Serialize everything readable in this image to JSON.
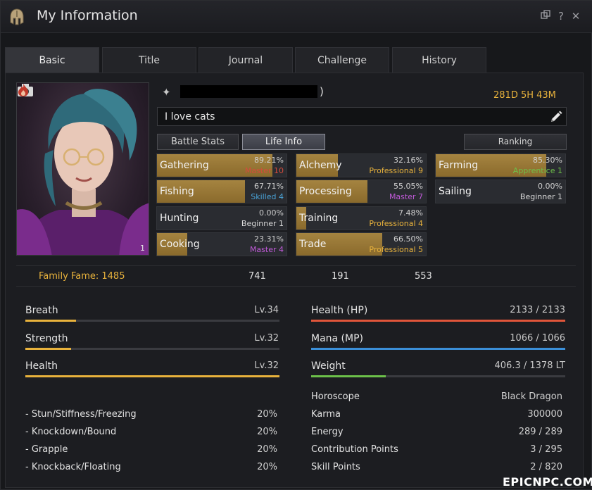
{
  "window": {
    "title": "My Information",
    "icons": {
      "title": "helmet-icon",
      "restore": "restore-icon",
      "help": "?",
      "close": "✕"
    }
  },
  "tabs": [
    {
      "label": "Basic",
      "active": true
    },
    {
      "label": "Title"
    },
    {
      "label": "Journal"
    },
    {
      "label": "Challenge"
    },
    {
      "label": "History"
    }
  ],
  "profile": {
    "name_suffix": ")",
    "playtime": "281D 5H 43M",
    "motto": "I love cats",
    "fire_count": "1"
  },
  "subtabs": {
    "battle": "Battle Stats",
    "life": "Life Info",
    "ranking": "Ranking"
  },
  "life_skills": [
    {
      "name": "Gathering",
      "pct": "89.21%",
      "level": "Master 10",
      "level_color": "#d44b3c",
      "fill": 0.8921
    },
    {
      "name": "Fishing",
      "pct": "67.71%",
      "level": "Skilled 4",
      "level_color": "#4aa3d8",
      "fill": 0.6771
    },
    {
      "name": "Hunting",
      "pct": "0.00%",
      "level": "Beginner 1",
      "level_color": "#d8d8d8",
      "fill": 0.0
    },
    {
      "name": "Cooking",
      "pct": "23.31%",
      "level": "Master 4",
      "level_color": "#c05ad8",
      "fill": 0.2331
    },
    {
      "name": "Alchemy",
      "pct": "32.16%",
      "level": "Professional 9",
      "level_color": "#e8b23c",
      "fill": 0.3216
    },
    {
      "name": "Processing",
      "pct": "55.05%",
      "level": "Master 7",
      "level_color": "#c05ad8",
      "fill": 0.5505
    },
    {
      "name": "Training",
      "pct": "7.48%",
      "level": "Professional 4",
      "level_color": "#e8b23c",
      "fill": 0.0748
    },
    {
      "name": "Trade",
      "pct": "66.50%",
      "level": "Professional 5",
      "level_color": "#e8b23c",
      "fill": 0.665
    },
    {
      "name": "Farming",
      "pct": "85.30%",
      "level": "Apprentice 1",
      "level_color": "#6ec04a",
      "fill": 0.853
    },
    {
      "name": "Sailing",
      "pct": "0.00%",
      "level": "Beginner 1",
      "level_color": "#d8d8d8",
      "fill": 0.0
    }
  ],
  "fame": {
    "label": "Family Fame: 1485",
    "a": "741",
    "b": "191",
    "c": "553"
  },
  "stats": [
    {
      "name": "Breath",
      "level": "Lv.34",
      "fill": 0.2,
      "color": "#e8b23c"
    },
    {
      "name": "Strength",
      "level": "Lv.32",
      "fill": 0.18,
      "color": "#e8b23c"
    },
    {
      "name": "Health",
      "level": "Lv.32",
      "fill": 1.0,
      "color": "#e8b23c"
    }
  ],
  "vitals": [
    {
      "name": "Health (HP)",
      "value": "2133 / 2133",
      "fill": 1.0,
      "color": "#e0553a"
    },
    {
      "name": "Mana (MP)",
      "value": "1066 / 1066",
      "fill": 1.0,
      "color": "#3b8fd8"
    },
    {
      "name": "Weight",
      "value": "406.3 / 1378 LT",
      "fill": 0.295,
      "color": "#6cc04a"
    }
  ],
  "resists": [
    {
      "name": "- Stun/Stiffness/Freezing",
      "value": "20%"
    },
    {
      "name": "- Knockdown/Bound",
      "value": "20%"
    },
    {
      "name": "- Grapple",
      "value": "20%"
    },
    {
      "name": "- Knockback/Floating",
      "value": "20%"
    }
  ],
  "info": [
    {
      "name": "Horoscope",
      "value": "Black Dragon"
    },
    {
      "name": "Karma",
      "value": "300000"
    },
    {
      "name": "Energy",
      "value": "289 / 289"
    },
    {
      "name": "Contribution Points",
      "value": "3 / 295"
    },
    {
      "name": "Skill Points",
      "value": "2 / 820"
    }
  ],
  "watermark": "EPICNPC.COM"
}
